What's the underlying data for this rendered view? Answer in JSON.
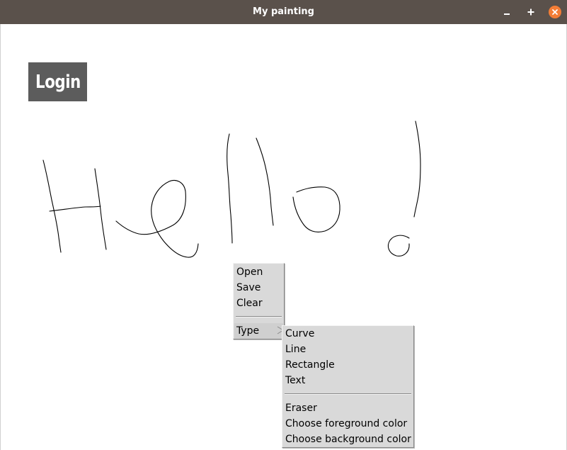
{
  "window": {
    "title": "My painting",
    "controls": {
      "minimize": "–",
      "maximize": "+",
      "close": "×"
    },
    "accent_close": "#f37d36",
    "titlebar_color": "#5a514b"
  },
  "canvas": {
    "login_badge_text": "Login",
    "badge_color": "#5c5c5c"
  },
  "context_menu": {
    "items": [
      "Open",
      "Save",
      "Clear"
    ],
    "submenu_label": "Type",
    "submenu_arrow_icon": "triangle-right-icon"
  },
  "type_submenu": {
    "items": [
      "Curve",
      "Line",
      "Rectangle",
      "Text"
    ],
    "tools": [
      "Eraser",
      "Choose foreground color",
      "Choose background color"
    ]
  }
}
